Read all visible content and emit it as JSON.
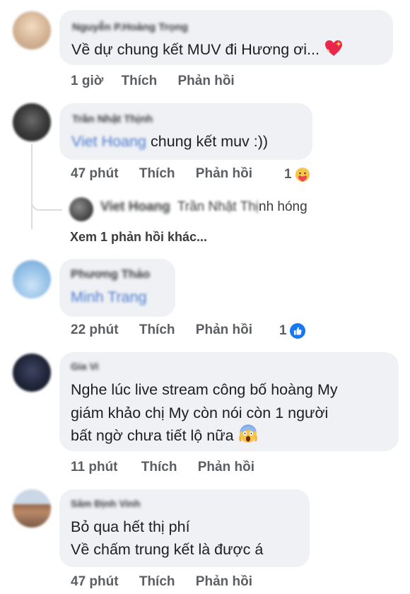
{
  "comments": [
    {
      "author": "Nguyễn P.Hoàng Trọng",
      "text": "Về dự chung kết MUV đi Hương ơi...",
      "time": "1 giờ",
      "like": "Thích",
      "reply": "Phản hồi"
    },
    {
      "author": "Trần Nhật Thịnh",
      "mention": "Viet Hoang",
      "text": "chung kết muv :))",
      "time": "47 phút",
      "like": "Thích",
      "reply": "Phản hồi",
      "reaction_count": "1",
      "reaction_icon": "care-emoji-icon"
    },
    {
      "nested_reply": {
        "author": "Viet Hoang",
        "mention": "Trần Nhật Thị",
        "text": "nh hóng"
      },
      "more_replies": "Xem 1 phản hồi khác..."
    },
    {
      "author": "Phương Thảo",
      "mention": "Minh Trang",
      "time": "22 phút",
      "like": "Thích",
      "reply": "Phản hồi",
      "reaction_count": "1",
      "reaction_icon": "like-icon"
    },
    {
      "author": "Gia Vi",
      "lines": [
        "Nghe lúc live stream công bố hoàng My",
        "giám khảo chị My còn nói còn 1 người",
        "bất ngờ chưa tiết lộ nữa"
      ],
      "time": "11 phút",
      "like": "Thích",
      "reply": "Phản hồi"
    },
    {
      "author": "Sâm Định Vinh",
      "lines": [
        "Bỏ qua hết thị phí",
        "Về chấm trung kết là được á"
      ],
      "time": "47 phút",
      "like": "Thích",
      "reply": "Phản hồi"
    }
  ],
  "colors": {
    "bubble": "#eff1f4",
    "meta": "#5b5e63",
    "mention": "#4b7bd0",
    "like_blue": "#1877f2"
  }
}
